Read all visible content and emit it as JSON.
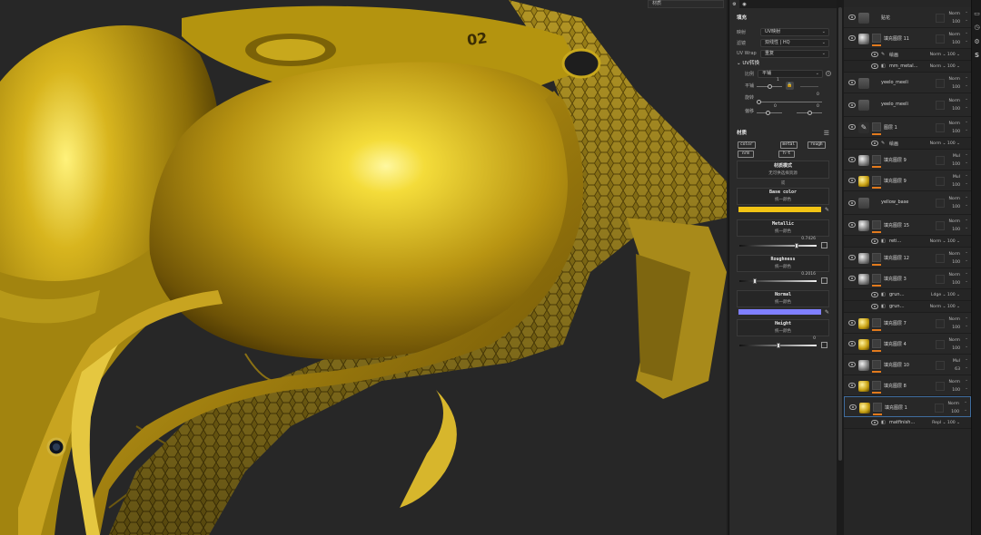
{
  "viewport": {
    "dropdown_label": "材质",
    "model_text": "02"
  },
  "properties": {
    "tabs": [
      "⚙",
      "◉"
    ],
    "fill_title": "填充",
    "mapping_label": "映射",
    "mapping_value": "UV映射",
    "filter_label": "滤镜",
    "filter_value": "双线性 | HQ",
    "uvwrap_label": "UV Wrap",
    "uvwrap_value": "重复",
    "uv_transform_title": "UV转换",
    "scale_label": "比例",
    "scale_value": "平铺",
    "scale_num": "1",
    "tile_label": "平铺",
    "rotate_label": "旋转",
    "rotate_num": "0",
    "offset_label": "偏移",
    "offset_x": "0",
    "offset_y": "0",
    "material_title": "材质",
    "channels": [
      "color",
      "metal",
      "rough",
      "nrm",
      "h-t"
    ],
    "material_mode_label": "材质模式",
    "material_mode_value": "无可供选择资源",
    "separator": "或",
    "base_color": {
      "title": "Base color",
      "sub": "统一颜色",
      "color": "#f2c415"
    },
    "metallic": {
      "title": "Metallic",
      "sub": "统一颜色",
      "value": "0.7426",
      "level": 0.7426
    },
    "roughness": {
      "title": "Roughness",
      "sub": "统一颜色",
      "value": "0.2016",
      "level": 0.2016
    },
    "normal": {
      "title": "Normal",
      "sub": "统一颜色",
      "color": "#7f7fff"
    },
    "height": {
      "title": "Height",
      "sub": "统一颜色",
      "value": "0",
      "level": 0.5
    }
  },
  "layers": {
    "accent": "#e27a1d",
    "rows": [
      {
        "name": "贴花",
        "blend": [
          "Norm",
          "100"
        ],
        "kind": "folder"
      },
      {
        "name": "填充图层 11",
        "blend": [
          "Norm",
          "100"
        ],
        "kind": "fill"
      },
      {
        "name": "绘画",
        "blend": [
          "Norm",
          "100"
        ],
        "kind": "paint-sub"
      },
      {
        "name": "mm_metal…",
        "blend": [
          "Norm",
          "100"
        ],
        "kind": "sub"
      },
      {
        "name": "yeelo_meeli",
        "blend": [
          "Norm",
          "100"
        ],
        "kind": "folder"
      },
      {
        "name": "yeelo_meeli",
        "blend": [
          "Norm",
          "100"
        ],
        "kind": "folder"
      },
      {
        "name": "图层 1",
        "blend": [
          "Norm",
          "100"
        ],
        "kind": "paint"
      },
      {
        "name": "绘画",
        "blend": [
          "Norm",
          "100"
        ],
        "kind": "paint-sub"
      },
      {
        "name": "填充图层 9",
        "blend": [
          "Mul",
          "100"
        ],
        "kind": "fill"
      },
      {
        "name": "填充图层 9",
        "blend": [
          "Mul",
          "100"
        ],
        "kind": "fill"
      },
      {
        "name": "yellow_base",
        "blend": [
          "Norm",
          "100"
        ],
        "kind": "folder"
      },
      {
        "name": "填充图层 15",
        "blend": [
          "Norm",
          "100"
        ],
        "kind": "fill"
      },
      {
        "name": "reti…",
        "blend": [
          "Norm",
          "100"
        ],
        "kind": "sub"
      },
      {
        "name": "填充图层 12",
        "blend": [
          "Norm",
          "100"
        ],
        "kind": "fill"
      },
      {
        "name": "填充图层 3",
        "blend": [
          "Norm",
          "100"
        ],
        "kind": "fill"
      },
      {
        "name": "grun…",
        "blend": [
          "Ldge",
          "100"
        ],
        "kind": "sub"
      },
      {
        "name": "grun…",
        "blend": [
          "Norm",
          "100"
        ],
        "kind": "sub"
      },
      {
        "name": "填充图层 7",
        "blend": [
          "Norm",
          "100"
        ],
        "kind": "fill"
      },
      {
        "name": "填充图层 4",
        "blend": [
          "Norm",
          "100"
        ],
        "kind": "fill"
      },
      {
        "name": "填充图层 10",
        "blend": [
          "Mul",
          "63"
        ],
        "kind": "fill"
      },
      {
        "name": "填充图层 8",
        "blend": [
          "Norm",
          "100"
        ],
        "kind": "fill"
      },
      {
        "name": "填充图层 1",
        "blend": [
          "Norm",
          "100"
        ],
        "kind": "fill"
      },
      {
        "name": "matfinish…",
        "blend": [
          "Repl",
          "100"
        ],
        "kind": "sub"
      }
    ]
  },
  "toolbar": {
    "icons": [
      "history-icon",
      "shelf-icon",
      "settings-icon",
      "substance-icon"
    ],
    "substance_glyph": "S"
  }
}
